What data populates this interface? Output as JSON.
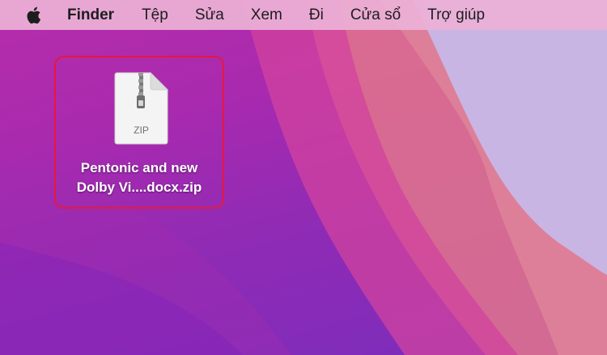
{
  "menubar": {
    "apple_icon": "apple-logo-icon",
    "app_name": "Finder",
    "items": [
      "Tệp",
      "Sửa",
      "Xem",
      "Đi",
      "Cửa sổ",
      "Trợ giúp"
    ]
  },
  "desktop": {
    "file": {
      "icon": "zip-archive-icon",
      "icon_text": "ZIP",
      "name_line1": "Pentonic and new",
      "name_line2": "Dolby Vi....docx.zip",
      "selection_color": "#e8173d"
    }
  },
  "colors": {
    "menubar_bg": "#ecb0d6",
    "wallpaper_primary": "#b52dab",
    "wallpaper_accent": "#e07a8a"
  }
}
